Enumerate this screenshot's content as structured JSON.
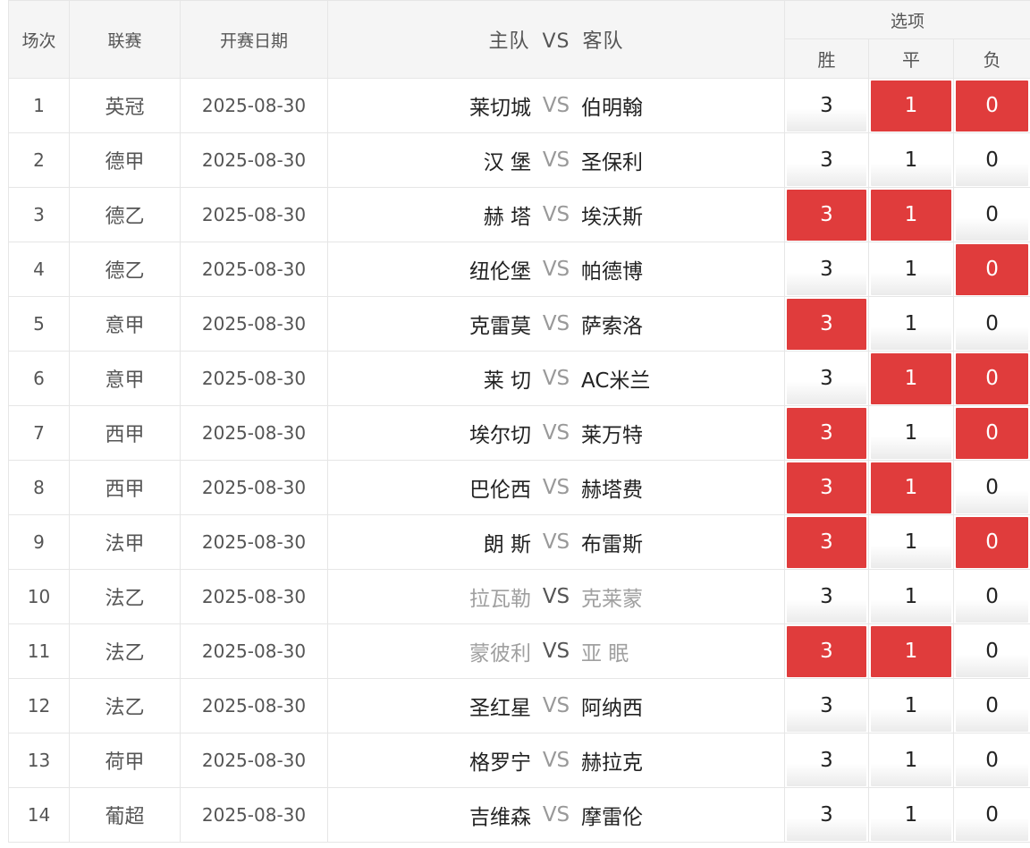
{
  "header": {
    "seq": "场次",
    "league": "联赛",
    "date": "开赛日期",
    "home": "主队",
    "vs": "VS",
    "away": "客队",
    "options": "选项",
    "win": "胜",
    "draw": "平",
    "lose": "负"
  },
  "colors": {
    "selected": "#e03c3c",
    "header_bg": "#f5f5f5"
  },
  "rows": [
    {
      "seq": "1",
      "league": "英冠",
      "date": "2025-08-30",
      "home": "莱切城",
      "vs": "VS",
      "away": "伯明翰",
      "win": "3",
      "draw": "1",
      "lose": "0",
      "win_sel": false,
      "draw_sel": true,
      "lose_sel": true,
      "dim": false
    },
    {
      "seq": "2",
      "league": "德甲",
      "date": "2025-08-30",
      "home": "汉 堡",
      "vs": "VS",
      "away": "圣保利",
      "win": "3",
      "draw": "1",
      "lose": "0",
      "win_sel": false,
      "draw_sel": false,
      "lose_sel": false,
      "dim": false
    },
    {
      "seq": "3",
      "league": "德乙",
      "date": "2025-08-30",
      "home": "赫 塔",
      "vs": "VS",
      "away": "埃沃斯",
      "win": "3",
      "draw": "1",
      "lose": "0",
      "win_sel": true,
      "draw_sel": true,
      "lose_sel": false,
      "dim": false
    },
    {
      "seq": "4",
      "league": "德乙",
      "date": "2025-08-30",
      "home": "纽伦堡",
      "vs": "VS",
      "away": "帕德博",
      "win": "3",
      "draw": "1",
      "lose": "0",
      "win_sel": false,
      "draw_sel": false,
      "lose_sel": true,
      "dim": false
    },
    {
      "seq": "5",
      "league": "意甲",
      "date": "2025-08-30",
      "home": "克雷莫",
      "vs": "VS",
      "away": "萨索洛",
      "win": "3",
      "draw": "1",
      "lose": "0",
      "win_sel": true,
      "draw_sel": false,
      "lose_sel": false,
      "dim": false
    },
    {
      "seq": "6",
      "league": "意甲",
      "date": "2025-08-30",
      "home": "莱 切",
      "vs": "VS",
      "away": "AC米兰",
      "win": "3",
      "draw": "1",
      "lose": "0",
      "win_sel": false,
      "draw_sel": true,
      "lose_sel": true,
      "dim": false
    },
    {
      "seq": "7",
      "league": "西甲",
      "date": "2025-08-30",
      "home": "埃尔切",
      "vs": "VS",
      "away": "莱万特",
      "win": "3",
      "draw": "1",
      "lose": "0",
      "win_sel": true,
      "draw_sel": false,
      "lose_sel": true,
      "dim": false
    },
    {
      "seq": "8",
      "league": "西甲",
      "date": "2025-08-30",
      "home": "巴伦西",
      "vs": "VS",
      "away": "赫塔费",
      "win": "3",
      "draw": "1",
      "lose": "0",
      "win_sel": true,
      "draw_sel": true,
      "lose_sel": false,
      "dim": false
    },
    {
      "seq": "9",
      "league": "法甲",
      "date": "2025-08-30",
      "home": "朗 斯",
      "vs": "VS",
      "away": "布雷斯",
      "win": "3",
      "draw": "1",
      "lose": "0",
      "win_sel": true,
      "draw_sel": false,
      "lose_sel": true,
      "dim": false
    },
    {
      "seq": "10",
      "league": "法乙",
      "date": "2025-08-30",
      "home": "拉瓦勒",
      "vs": "VS",
      "away": "克莱蒙",
      "win": "3",
      "draw": "1",
      "lose": "0",
      "win_sel": false,
      "draw_sel": false,
      "lose_sel": false,
      "dim": true
    },
    {
      "seq": "11",
      "league": "法乙",
      "date": "2025-08-30",
      "home": "蒙彼利",
      "vs": "VS",
      "away": "亚 眠",
      "win": "3",
      "draw": "1",
      "lose": "0",
      "win_sel": true,
      "draw_sel": true,
      "lose_sel": false,
      "dim": true
    },
    {
      "seq": "12",
      "league": "法乙",
      "date": "2025-08-30",
      "home": "圣红星",
      "vs": "VS",
      "away": "阿纳西",
      "win": "3",
      "draw": "1",
      "lose": "0",
      "win_sel": false,
      "draw_sel": false,
      "lose_sel": false,
      "dim": false
    },
    {
      "seq": "13",
      "league": "荷甲",
      "date": "2025-08-30",
      "home": "格罗宁",
      "vs": "VS",
      "away": "赫拉克",
      "win": "3",
      "draw": "1",
      "lose": "0",
      "win_sel": false,
      "draw_sel": false,
      "lose_sel": false,
      "dim": false
    },
    {
      "seq": "14",
      "league": "葡超",
      "date": "2025-08-30",
      "home": "吉维森",
      "vs": "VS",
      "away": "摩雷伦",
      "win": "3",
      "draw": "1",
      "lose": "0",
      "win_sel": false,
      "draw_sel": false,
      "lose_sel": false,
      "dim": false
    }
  ]
}
